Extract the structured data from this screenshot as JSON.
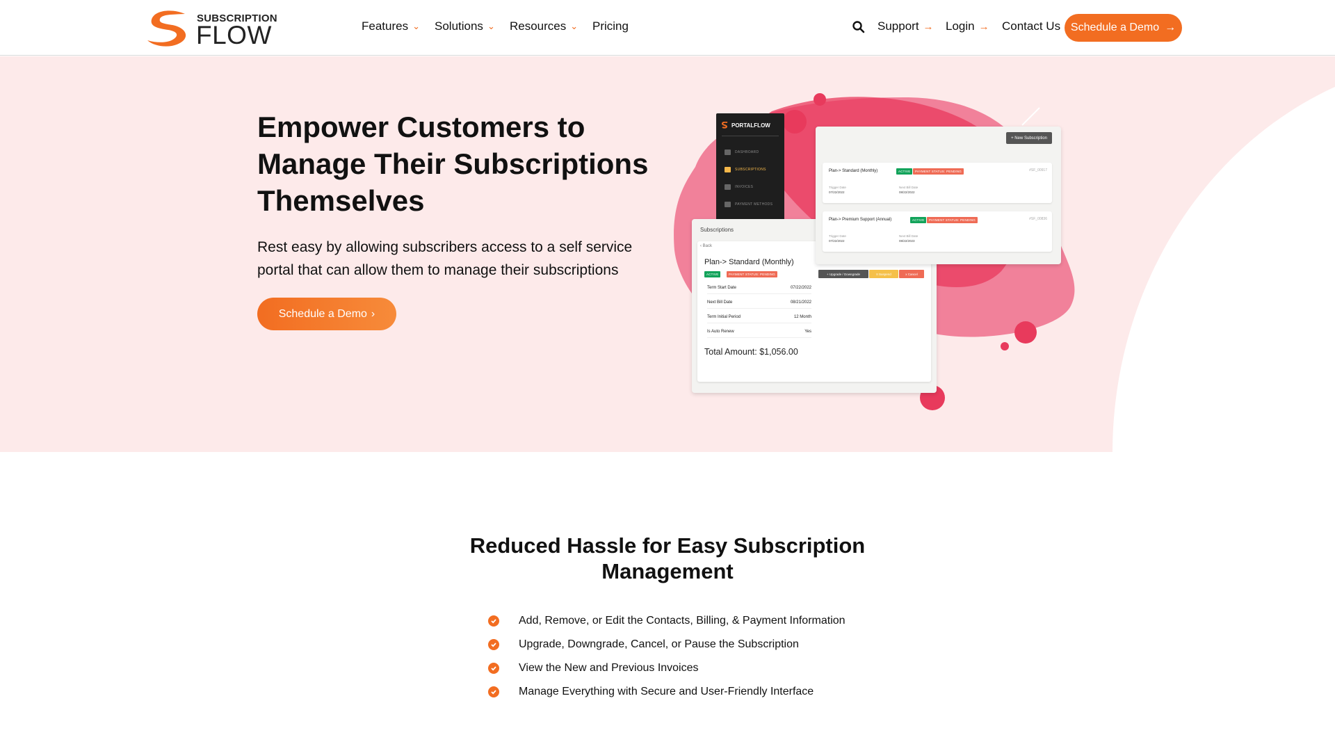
{
  "header": {
    "logo_top": "SUBSCRIPTION",
    "logo_bottom": "FLOW",
    "nav": [
      "Features",
      "Solutions",
      "Resources",
      "Pricing"
    ],
    "right_links": [
      "Support",
      "Login",
      "Contact Us"
    ],
    "cta": "Schedule a Demo",
    "colors": {
      "accent": "#f26d21"
    }
  },
  "hero": {
    "title": "Empower Customers to Manage Their Subscriptions Themselves",
    "description": "Rest easy by allowing subscribers access to a self service portal that can allow them to manage their subscriptions",
    "cta": "Schedule a Demo",
    "background": "#fdeaea"
  },
  "mockup": {
    "brand": "PORTALFLOW",
    "sidebar": [
      "DASHBOARD",
      "SUBSCRIPTIONS",
      "INVOICES",
      "PAYMENT METHODS"
    ],
    "detail": {
      "header": "Subscriptions",
      "back": "‹ Back",
      "plan": "Plan-> Standard (Monthly)",
      "badge_active": "ACTIVE",
      "badge_pending": "PAYMENT STATUS: PENDING",
      "rows": [
        {
          "label": "Term Start Date",
          "value": "07/22/2022"
        },
        {
          "label": "Next Bill Date",
          "value": "08/21/2022"
        },
        {
          "label": "Term Initial Period",
          "value": "12 Month"
        },
        {
          "label": "Is Auto Renew",
          "value": "Yes"
        }
      ],
      "total": "Total Amount: $1,056.00",
      "actions": [
        "+ Upgrade / Downgrade",
        "II Suspend",
        "x Cancel"
      ]
    },
    "list": {
      "new_button": "+ New Subscription",
      "items": [
        {
          "plan": "Plan-> Standard (Monthly)",
          "id": "#SF_00917",
          "trigger_label": "Trigger Date",
          "trigger": "07/22/2022",
          "next_label": "Next Bill Date",
          "next": "08/22/2022"
        },
        {
          "plan": "Plan-> Premium Support (Annual)",
          "id": "#SF_00836",
          "trigger_label": "Trigger Date",
          "trigger": "07/22/2022",
          "next_label": "Next Bill Date",
          "next": "08/22/2023"
        }
      ]
    }
  },
  "features": {
    "title": "Reduced Hassle for Easy Subscription Management",
    "items": [
      "Add, Remove, or Edit the Contacts, Billing, & Payment Information",
      "Upgrade, Downgrade, Cancel, or Pause the Subscription",
      "View the New and Previous Invoices",
      "Manage Everything with Secure and User-Friendly Interface"
    ]
  }
}
